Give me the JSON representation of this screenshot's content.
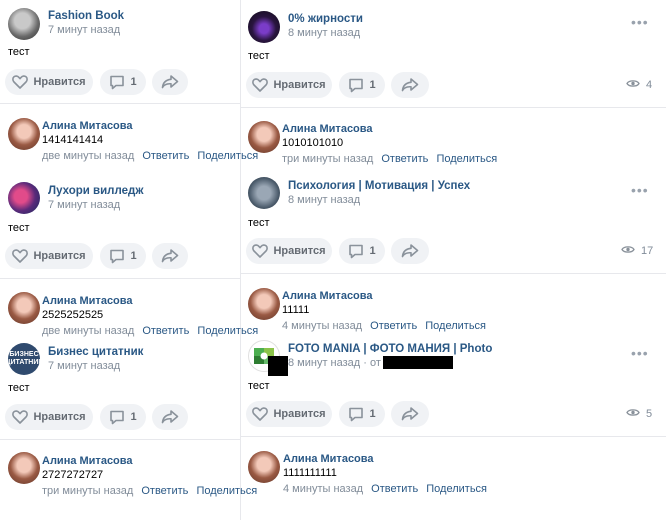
{
  "icons": {
    "like": "heart-outline-icon",
    "comment": "comment-bubble-icon",
    "share": "share-arrow-icon",
    "views": "eye-icon",
    "more": "more-dots-icon"
  },
  "colors": {
    "link": "#2a5885",
    "muted": "#818c99",
    "pill_bg": "#f0f2f5",
    "pill_text": "#656b73"
  },
  "actions": {
    "like_label": "Нравится",
    "reply_label": "Ответить",
    "share_label": "Поделиться"
  },
  "left": {
    "posts": [
      {
        "author": "Fashion Book",
        "time": "7 минут назад",
        "text": "тест",
        "comments": "1",
        "comment": {
          "author": "Алина Митасова",
          "text": "1414141414",
          "time": "две минуты назад"
        }
      },
      {
        "author": "Лухори вилледж",
        "time": "7 минут назад",
        "text": "тест",
        "comments": "1",
        "comment": {
          "author": "Алина Митасова",
          "text": "2525252525",
          "time": "две минуты назад"
        }
      },
      {
        "author": "Бизнес цитатник",
        "avatar_text": "БИЗНЕС ЦИТАТНИК",
        "time": "7 минут назад",
        "text": "тест",
        "comments": "1",
        "comment": {
          "author": "Алина Митасова",
          "text": "2727272727",
          "time": "три минуты назад"
        }
      }
    ]
  },
  "right": {
    "posts": [
      {
        "author": "0% жирности",
        "time": "8 минут назад",
        "text": "тест",
        "comments": "1",
        "views": "4",
        "comment": {
          "author": "Алина Митасова",
          "text": "1010101010",
          "time": "три минуты назад"
        }
      },
      {
        "author": "Психология | Мотивация | Успех",
        "time": "8 минут назад",
        "text": "тест",
        "comments": "1",
        "views": "17",
        "comment": {
          "author": "Алина Митасова",
          "text": "11111",
          "time": "4 минуты назад"
        }
      },
      {
        "author": "FOTO MANIA | ФОТО МАНИЯ | Photo",
        "time": "8 минут назад",
        "from_label": "· от",
        "text": "тест",
        "comments": "1",
        "views": "5",
        "comment": {
          "author": "Алина Митасова",
          "text": "1111111111",
          "time": "4 минуты назад"
        }
      }
    ]
  }
}
